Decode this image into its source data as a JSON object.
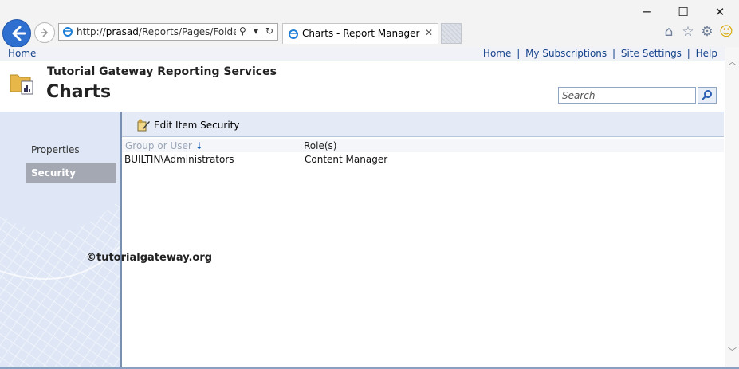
{
  "browser": {
    "address_url_prefix": "http://",
    "address_url_host": "prasad",
    "address_url_path": "/Reports/Pages/Folder.a",
    "tab_title": "Charts - Report Manager",
    "window_controls": {
      "minimize": "─",
      "maximize": "☐",
      "close": "✕"
    }
  },
  "topbar": {
    "home_left": "Home",
    "links": {
      "home": "Home",
      "subscriptions": "My Subscriptions",
      "site_settings": "Site Settings",
      "help": "Help"
    },
    "separator": "|"
  },
  "header": {
    "site_title": "Tutorial Gateway Reporting Services",
    "page_title": "Charts",
    "search_placeholder": "Search"
  },
  "sidebar": {
    "items": [
      {
        "label": "Properties",
        "selected": false
      },
      {
        "label": "Security",
        "selected": true
      }
    ],
    "watermark": "©tutorialgateway.org"
  },
  "toolbar": {
    "edit_security_label": "Edit Item Security"
  },
  "table": {
    "columns": {
      "group_or_user": "Group or User",
      "sort_arrow": "↓",
      "roles": "Role(s)"
    },
    "rows": [
      {
        "user": "BUILTIN\\Administrators",
        "role": "Content Manager"
      }
    ]
  },
  "colors": {
    "link": "#15428b",
    "back_button": "#2f6fd0",
    "nav_selected": "#a3a8b3"
  }
}
